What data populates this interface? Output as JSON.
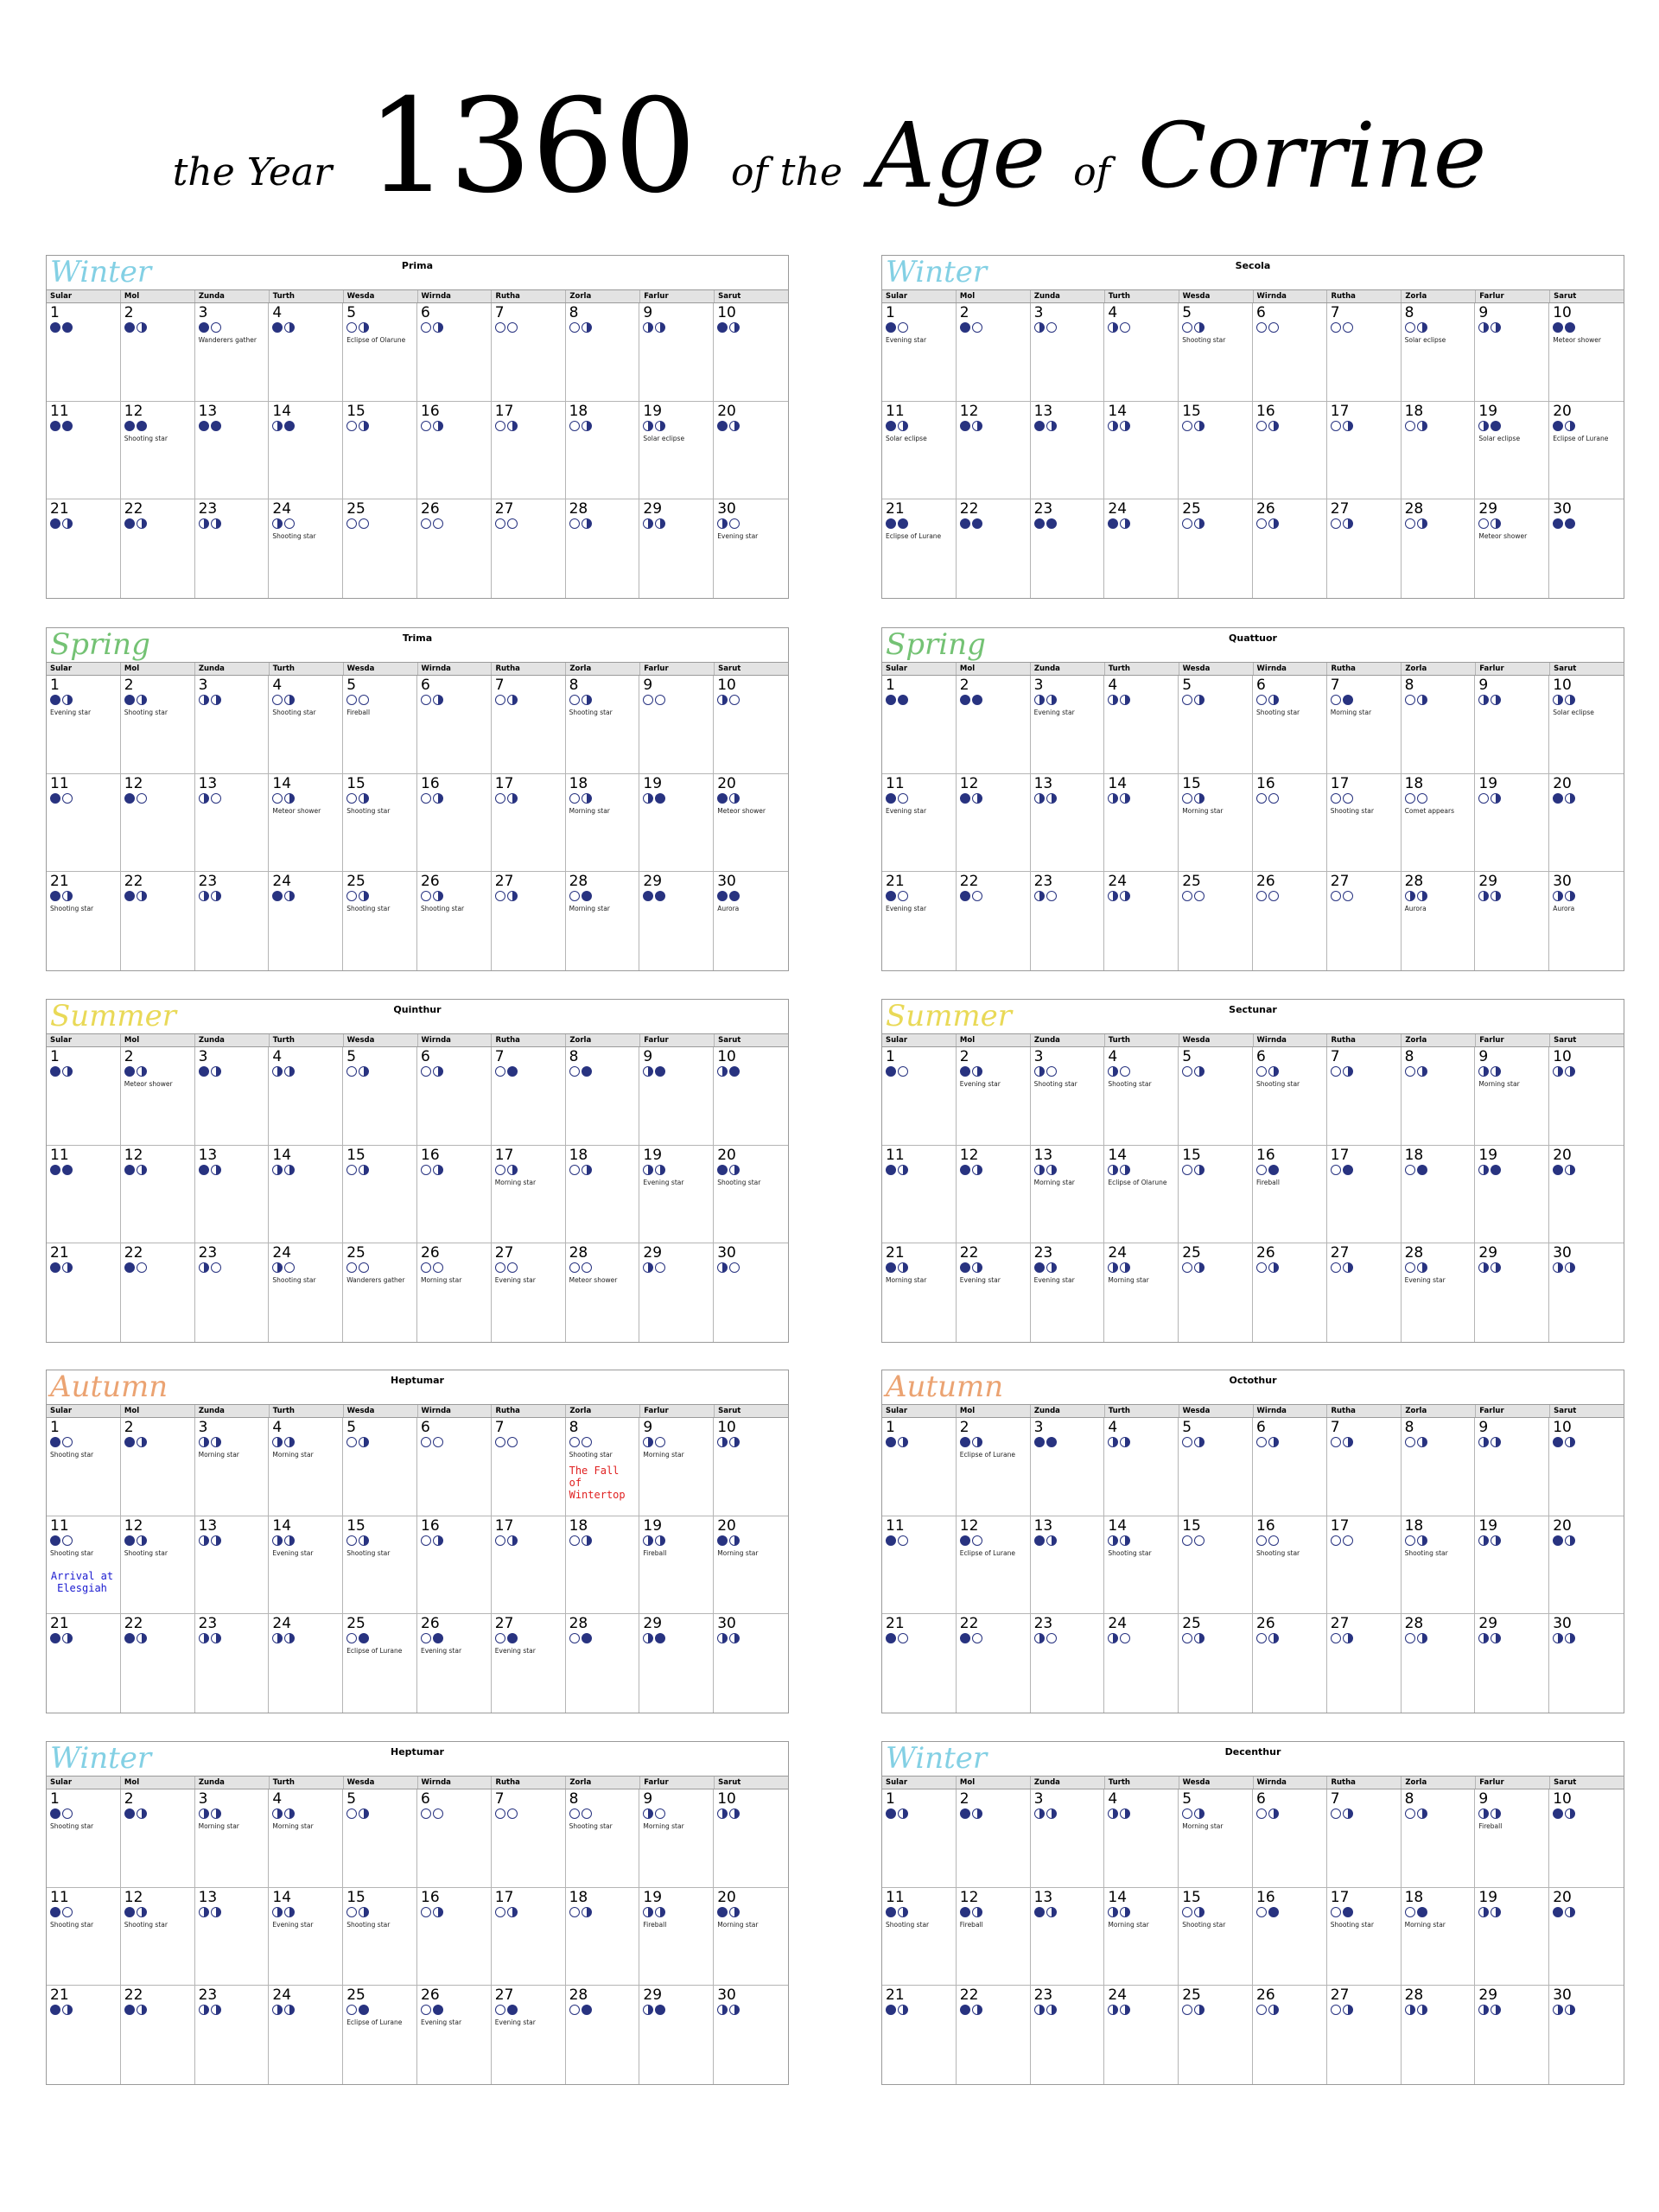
{
  "title": {
    "part1": "the Year",
    "year": "1360",
    "part2": "of the",
    "age": "Age",
    "part3": "of",
    "name": "Corrine"
  },
  "colors": {
    "moon": "#283380",
    "winter": "#6ec8e0",
    "spring": "#5cb85c",
    "summer": "#e6d33a",
    "autumn": "#e8945a",
    "note_red": "#e02020",
    "note_blue": "#1a1ad0"
  },
  "weekdays": [
    "Sular",
    "Mol",
    "Zunda",
    "Turth",
    "Wesda",
    "Wirnda",
    "Rutha",
    "Zorla",
    "Farlur",
    "Sarut"
  ],
  "months": [
    {
      "season": "Winter",
      "name": "Prima",
      "moons": [
        "FF",
        "FR",
        "FW",
        "FR",
        "WR",
        "WR",
        "WW",
        "WR",
        "RR",
        "FR",
        "FF",
        "FF",
        "FF",
        "RF",
        "WR",
        "WR",
        "WR",
        "WR",
        "RR",
        "FR",
        "FR",
        "FR",
        "RR",
        "RW",
        "WW",
        "WW",
        "WW",
        "WR",
        "RR",
        "RW"
      ],
      "events": {
        "3": "Wanderers gather",
        "5": "Eclipse of Olarune",
        "12": "Shooting star",
        "19": "Solar eclipse",
        "24": "Shooting star",
        "30": "Evening star"
      }
    },
    {
      "season": "Winter",
      "name": "Secola",
      "moons": [
        "FW",
        "FW",
        "RW",
        "RW",
        "WR",
        "WW",
        "WW",
        "WR",
        "RR",
        "FF",
        "FR",
        "FR",
        "FR",
        "RR",
        "WR",
        "WR",
        "WR",
        "WR",
        "RF",
        "FR",
        "FF",
        "FF",
        "FF",
        "FR",
        "WR",
        "WR",
        "WR",
        "WR",
        "WR",
        "FF"
      ],
      "events": {
        "1": "Evening star",
        "5": "Shooting star",
        "8": "Solar eclipse",
        "10": "Meteor shower",
        "11": "Solar eclipse",
        "19": "Solar eclipse",
        "20": "Eclipse of Lurane",
        "21": "Eclipse of Lurane",
        "29": "Meteor shower"
      }
    },
    {
      "season": "Spring",
      "name": "Trima",
      "moons": [
        "FR",
        "FR",
        "RR",
        "WR",
        "WW",
        "WR",
        "WR",
        "WR",
        "WW",
        "RW",
        "FW",
        "FW",
        "RW",
        "WR",
        "WR",
        "WR",
        "WR",
        "WR",
        "RF",
        "FR",
        "FR",
        "FR",
        "RR",
        "FR",
        "WR",
        "WR",
        "WR",
        "WF",
        "FF",
        "FF"
      ],
      "events": {
        "1": "Evening star",
        "2": "Shooting star",
        "4": "Shooting star",
        "5": "Fireball",
        "8": "Shooting star",
        "14": "Meteor shower",
        "15": "Shooting star",
        "18": "Morning star",
        "20": "Meteor shower",
        "21": "Shooting star",
        "25": "Shooting star",
        "26": "Shooting star",
        "28": "Morning star",
        "30": "Aurora"
      }
    },
    {
      "season": "Spring",
      "name": "Quattuor",
      "moons": [
        "FF",
        "FF",
        "RR",
        "RR",
        "WR",
        "WR",
        "WF",
        "WR",
        "RR",
        "RR",
        "FW",
        "FR",
        "RR",
        "RR",
        "WR",
        "WW",
        "WW",
        "WW",
        "WR",
        "FR",
        "FW",
        "FW",
        "RW",
        "RR",
        "WW",
        "WW",
        "WW",
        "RR",
        "RR",
        "RR"
      ],
      "events": {
        "3": "Evening star",
        "6": "Shooting star",
        "7": "Morning star",
        "10": "Solar eclipse",
        "11": "Evening star",
        "15": "Morning star",
        "17": "Shooting star",
        "18": "Comet appears",
        "21": "Evening star",
        "28": "Aurora",
        "30": "Aurora"
      }
    },
    {
      "season": "Summer",
      "name": "Quinthur",
      "moons": [
        "FR",
        "FR",
        "FR",
        "RR",
        "WR",
        "WR",
        "WF",
        "WF",
        "RF",
        "RF",
        "FF",
        "FR",
        "FR",
        "RR",
        "WR",
        "WR",
        "WR",
        "WR",
        "RR",
        "FR",
        "FR",
        "FW",
        "RW",
        "RW",
        "WW",
        "WW",
        "WW",
        "WW",
        "RW",
        "RW"
      ],
      "events": {
        "2": "Meteor shower",
        "17": "Morning star",
        "19": "Evening star",
        "20": "Shooting star",
        "24": "Shooting star",
        "25": "Wanderers gather",
        "26": "Morning star",
        "27": "Evening star",
        "28": "Meteor shower"
      }
    },
    {
      "season": "Summer",
      "name": "Sectunar",
      "moons": [
        "FW",
        "FR",
        "RW",
        "RW",
        "WR",
        "WR",
        "WR",
        "WR",
        "RR",
        "RR",
        "FR",
        "FR",
        "RR",
        "RR",
        "WR",
        "WF",
        "WF",
        "WF",
        "RF",
        "FR",
        "FR",
        "FR",
        "FR",
        "RR",
        "WR",
        "WR",
        "WR",
        "WR",
        "RR",
        "RR"
      ],
      "events": {
        "2": "Evening star",
        "3": "Shooting star",
        "4": "Shooting star",
        "6": "Shooting star",
        "9": "Morning star",
        "13": "Morning star",
        "14": "Eclipse of Olarune",
        "16": "Fireball",
        "21": "Morning star",
        "22": "Evening star",
        "23": "Evening star",
        "24": "Morning star",
        "28": "Evening star"
      }
    },
    {
      "season": "Autumn",
      "name": "Heptumar",
      "moons": [
        "FW",
        "FR",
        "RR",
        "RR",
        "WR",
        "WW",
        "WW",
        "WW",
        "RW",
        "RR",
        "FW",
        "FR",
        "RR",
        "RR",
        "WR",
        "WR",
        "WR",
        "WR",
        "RR",
        "FR",
        "FR",
        "FR",
        "RR",
        "RR",
        "WF",
        "WF",
        "WF",
        "WF",
        "RF",
        "RR"
      ],
      "events": {
        "1": "Shooting star",
        "3": "Morning star",
        "4": "Morning star",
        "8": "Shooting star",
        "9": "Morning star",
        "11": "Shooting star",
        "12": "Shooting star",
        "14": "Evening star",
        "15": "Shooting star",
        "19": "Fireball",
        "20": "Morning star",
        "25": "Eclipse of Lurane",
        "26": "Evening star",
        "27": "Evening star"
      },
      "notes": [
        {
          "day": "8",
          "text": "The Fall of Wintertop",
          "color": "#e02020"
        },
        {
          "day": "11",
          "text": "Arrival at Elesgiah",
          "color": "#1a1ad0"
        }
      ]
    },
    {
      "season": "Autumn",
      "name": "Octothur",
      "moons": [
        "FR",
        "FR",
        "FF",
        "RR",
        "WR",
        "WR",
        "WR",
        "WR",
        "RR",
        "FR",
        "FW",
        "FW",
        "FR",
        "RR",
        "WW",
        "WW",
        "WW",
        "WR",
        "RR",
        "FR",
        "FW",
        "FW",
        "RW",
        "RW",
        "WR",
        "WR",
        "WR",
        "WR",
        "RR",
        "RR"
      ],
      "events": {
        "2": "Eclipse of Lurane",
        "12": "Eclipse of Lurane",
        "14": "Shooting star",
        "16": "Shooting star",
        "18": "Shooting star"
      }
    },
    {
      "season": "Winter",
      "name": "Heptumar",
      "moons": [
        "FW",
        "FR",
        "RR",
        "RR",
        "WR",
        "WW",
        "WW",
        "WW",
        "RW",
        "RR",
        "FW",
        "FR",
        "RR",
        "RR",
        "WR",
        "WR",
        "WR",
        "WR",
        "RR",
        "FR",
        "FR",
        "FR",
        "RR",
        "RR",
        "WF",
        "WF",
        "WF",
        "WF",
        "RF",
        "RR"
      ],
      "events": {
        "1": "Shooting star",
        "3": "Morning star",
        "4": "Morning star",
        "8": "Shooting star",
        "9": "Morning star",
        "11": "Shooting star",
        "12": "Shooting star",
        "14": "Evening star",
        "15": "Shooting star",
        "19": "Fireball",
        "20": "Morning star",
        "25": "Eclipse of Lurane",
        "26": "Evening star",
        "27": "Evening star"
      }
    },
    {
      "season": "Winter",
      "name": "Decenthur",
      "moons": [
        "FR",
        "FR",
        "RR",
        "RR",
        "WR",
        "WR",
        "WR",
        "WR",
        "RR",
        "FR",
        "FR",
        "FR",
        "FR",
        "RR",
        "WR",
        "WF",
        "WF",
        "WF",
        "RR",
        "FR",
        "FR",
        "FR",
        "RR",
        "RR",
        "WR",
        "WR",
        "WR",
        "RR",
        "RR",
        "RR"
      ],
      "events": {
        "5": "Morning star",
        "9": "Fireball",
        "11": "Shooting star",
        "12": "Fireball",
        "14": "Morning star",
        "15": "Shooting star",
        "17": "Shooting star",
        "18": "Morning star"
      }
    }
  ]
}
